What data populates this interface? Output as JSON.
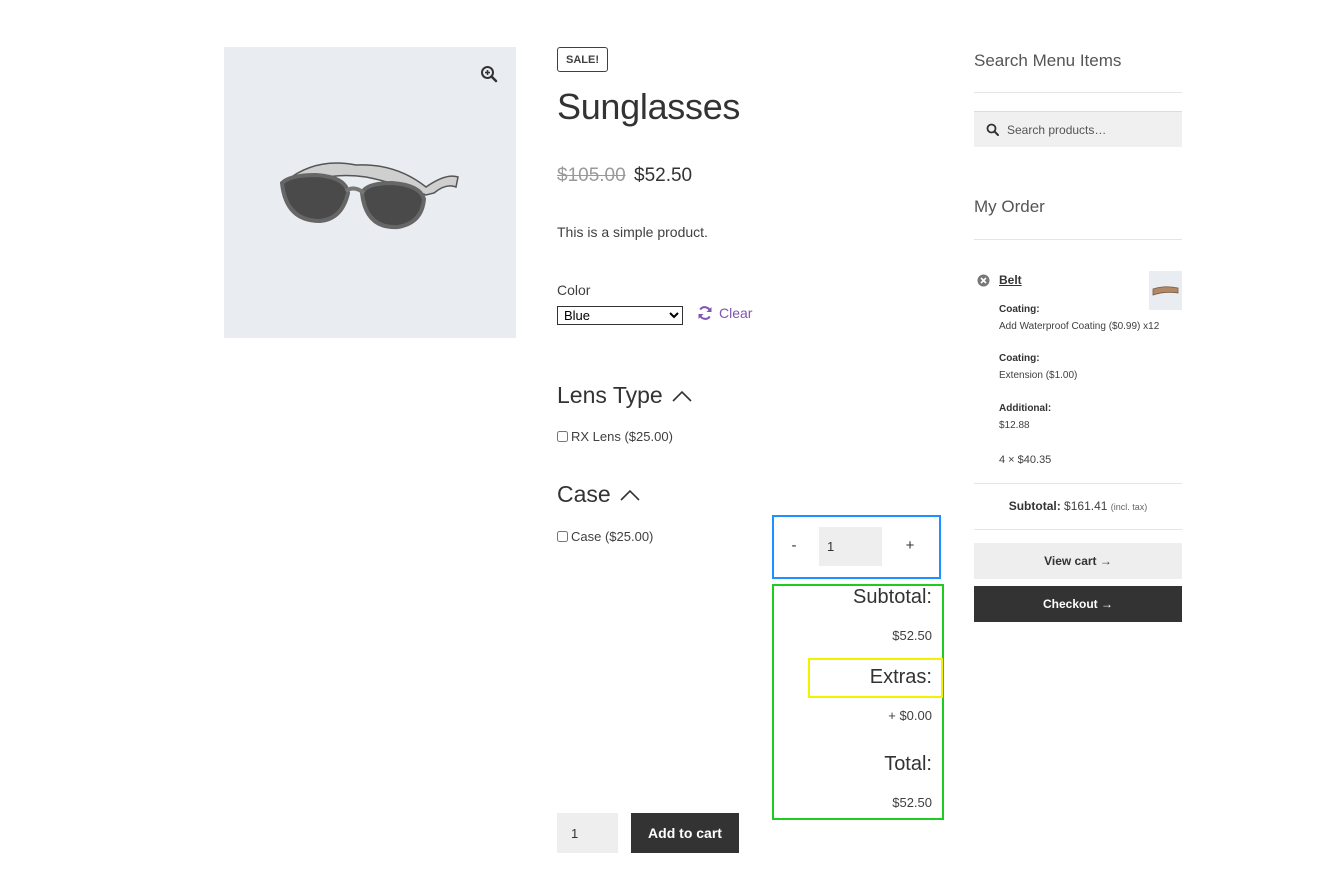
{
  "product": {
    "sale_badge": "SALE!",
    "title": "Sunglasses",
    "price_regular": "$105.00",
    "price_sale": "$52.50",
    "description": "This is a simple product.",
    "color_label": "Color",
    "color_selected": "Blue",
    "clear_label": "Clear"
  },
  "addons": {
    "lens_type": {
      "heading": "Lens Type",
      "option": "RX Lens ($25.00)"
    },
    "case": {
      "heading": "Case",
      "option": "Case ($25.00)"
    }
  },
  "stepper": {
    "minus": "-",
    "value": "1",
    "plus": "+"
  },
  "totals": {
    "subtotal_label": "Subtotal:",
    "subtotal_value": "$52.50",
    "extras_label": "Extras:",
    "extras_value": "+ $0.00",
    "total_label": "Total:",
    "total_value": "$52.50"
  },
  "cart_form": {
    "quantity": "1",
    "add_to_cart": "Add to cart"
  },
  "sidebar": {
    "search_title": "Search Menu Items",
    "search_placeholder": "Search products…",
    "order_title": "My Order",
    "item": {
      "name": "Belt",
      "meta": [
        {
          "key": "Coating:",
          "value": "Add Waterproof Coating ($0.99) x12"
        },
        {
          "key": "Coating:",
          "value": "Extension ($1.00)"
        },
        {
          "key": "Additional:",
          "value": "$12.88"
        }
      ],
      "quantity_line": "4 × $40.35"
    },
    "subtotal_label": "Subtotal:",
    "subtotal_value": "$161.41",
    "subtotal_note": "(incl. tax)",
    "view_cart": "View cart",
    "checkout": "Checkout"
  },
  "colors": {
    "accent_link": "#7f54b3",
    "dark_button": "#333333",
    "stepper_outline": "#1e90ff",
    "totals_outline": "#1dcc1d",
    "extras_outline": "#f2f200"
  }
}
